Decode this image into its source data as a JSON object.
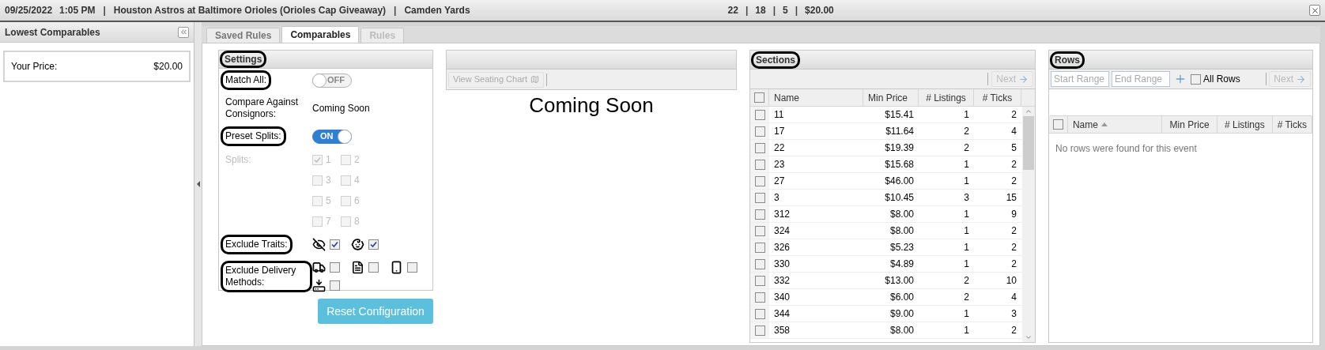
{
  "header": {
    "date": "09/25/2022",
    "time": "1:05 PM",
    "separator_1": "|",
    "event": "Houston Astros at Baltimore Orioles (Orioles Cap Giveaway)",
    "separator_2": "|",
    "venue": "Camden Yards",
    "stats": [
      "22",
      "18",
      "5",
      "$20.00"
    ],
    "stat_separators": [
      "|",
      "|",
      "|"
    ]
  },
  "left_panel": {
    "title": "Lowest Comparables",
    "price_label": "Your Price:",
    "price_value": "$20.00"
  },
  "tabs": [
    {
      "label": "Saved Rules",
      "selected": false,
      "disabled": false
    },
    {
      "label": "Comparables",
      "selected": true,
      "disabled": false
    },
    {
      "label": "Rules",
      "selected": false,
      "disabled": true
    }
  ],
  "settings": {
    "title": "Settings",
    "title_highlighted": true,
    "match_all": {
      "label": "Match All:",
      "highlighted": true,
      "on": false,
      "text": "OFF"
    },
    "compare": {
      "label": "Compare Against Consignors:",
      "value": "Coming Soon"
    },
    "preset_splits": {
      "label": "Preset Splits:",
      "highlighted": true,
      "on": true,
      "text": "ON"
    },
    "splits": {
      "label": "Splits:",
      "disabled": true,
      "options": [
        {
          "label": "1",
          "checked": true
        },
        {
          "label": "2",
          "checked": false
        },
        {
          "label": "3",
          "checked": false
        },
        {
          "label": "4",
          "checked": false
        },
        {
          "label": "5",
          "checked": false
        },
        {
          "label": "6",
          "checked": false
        },
        {
          "label": "7",
          "checked": false
        },
        {
          "label": "8",
          "checked": false
        }
      ]
    },
    "exclude_traits": {
      "label": "Exclude Traits:",
      "highlighted": true,
      "items": [
        {
          "kind": "hidden",
          "checked": true
        },
        {
          "kind": "child",
          "checked": true
        }
      ]
    },
    "exclude_delivery": {
      "label": "Exclude Delivery Methods:",
      "highlighted": true,
      "items": [
        {
          "kind": "truck",
          "checked": false
        },
        {
          "kind": "pdf",
          "checked": false
        },
        {
          "kind": "phone",
          "checked": false
        },
        {
          "kind": "download",
          "checked": false
        }
      ]
    },
    "reset_button": "Reset Configuration"
  },
  "seating": {
    "button": "View Seating Chart",
    "message": "Coming Soon"
  },
  "sections": {
    "title": "Sections",
    "title_highlighted": true,
    "next": "Next",
    "all_checked": false,
    "columns": [
      "Name",
      "Min Price",
      "# Listings",
      "# Ticks"
    ],
    "rows": [
      {
        "name": "11",
        "min_price": "$15.41",
        "listings": "1",
        "ticks": "2",
        "checked": false
      },
      {
        "name": "17",
        "min_price": "$11.64",
        "listings": "2",
        "ticks": "4",
        "checked": false
      },
      {
        "name": "22",
        "min_price": "$19.39",
        "listings": "2",
        "ticks": "5",
        "checked": false
      },
      {
        "name": "23",
        "min_price": "$15.68",
        "listings": "1",
        "ticks": "2",
        "checked": false
      },
      {
        "name": "27",
        "min_price": "$46.00",
        "listings": "1",
        "ticks": "2",
        "checked": false
      },
      {
        "name": "3",
        "min_price": "$10.45",
        "listings": "3",
        "ticks": "15",
        "checked": false
      },
      {
        "name": "312",
        "min_price": "$8.00",
        "listings": "1",
        "ticks": "9",
        "checked": false
      },
      {
        "name": "324",
        "min_price": "$8.00",
        "listings": "1",
        "ticks": "2",
        "checked": false
      },
      {
        "name": "326",
        "min_price": "$5.23",
        "listings": "1",
        "ticks": "2",
        "checked": false
      },
      {
        "name": "330",
        "min_price": "$4.89",
        "listings": "1",
        "ticks": "2",
        "checked": false
      },
      {
        "name": "332",
        "min_price": "$13.00",
        "listings": "2",
        "ticks": "10",
        "checked": false
      },
      {
        "name": "340",
        "min_price": "$6.00",
        "listings": "2",
        "ticks": "4",
        "checked": false
      },
      {
        "name": "344",
        "min_price": "$9.00",
        "listings": "1",
        "ticks": "3",
        "checked": false
      },
      {
        "name": "358",
        "min_price": "$8.00",
        "listings": "1",
        "ticks": "2",
        "checked": false
      }
    ]
  },
  "rows_panel": {
    "title": "Rows",
    "title_highlighted": true,
    "start_placeholder": "Start Range",
    "end_placeholder": "End Range",
    "all_rows": {
      "label": "All Rows",
      "checked": false
    },
    "next": "Next",
    "all_checked": false,
    "columns": [
      {
        "label": "Name",
        "sorted": true
      },
      {
        "label": "Min Price",
        "sorted": false
      },
      {
        "label": "# Listings",
        "sorted": false
      },
      {
        "label": "# Ticks",
        "sorted": false
      }
    ],
    "empty": "No rows were found for this event"
  }
}
